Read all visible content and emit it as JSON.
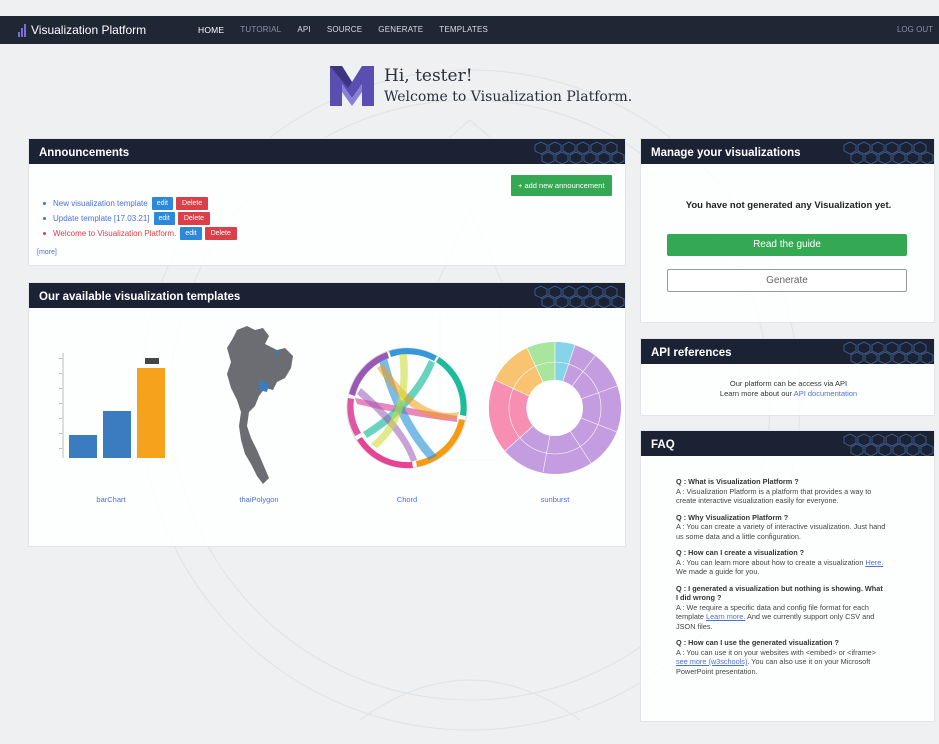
{
  "navbar": {
    "brand": "Visualization Platform",
    "links": [
      "HOME",
      "TUTORIAL",
      "API",
      "SOURCE",
      "GENERATE",
      "TEMPLATES"
    ],
    "logout": "LOG OUT"
  },
  "welcome": {
    "greeting": "Hi, tester!",
    "subtitle": "Welcome to Visualization Platform."
  },
  "announcements": {
    "title": "Announcements",
    "add_button": "+ add new announcement",
    "items": [
      {
        "text": "New visualization template",
        "edit": "edit",
        "delete": "Delete"
      },
      {
        "text": "Update template [17.03.21]",
        "edit": "edit",
        "delete": "Delete"
      },
      {
        "text": "Welcome to Visualization Platform.",
        "edit": "edit",
        "delete": "Delete"
      }
    ],
    "more": "[more]"
  },
  "templates": {
    "title": "Our available visualization templates",
    "items": [
      {
        "label": "barChart",
        "icon": "bar-chart-thumbnail"
      },
      {
        "label": "thaiPolygon",
        "icon": "thailand-map-thumbnail"
      },
      {
        "label": "Chord",
        "icon": "chord-diagram-thumbnail"
      },
      {
        "label": "sunburst",
        "icon": "sunburst-thumbnail"
      }
    ]
  },
  "manage": {
    "title": "Manage your visualizations",
    "empty_message": "You have not generated any Visualization yet.",
    "guide_button": "Read the guide",
    "generate_button": "Generate"
  },
  "api": {
    "title": "API references",
    "line1": "Our platform can be access via API",
    "line2_prefix": "Learn more about our",
    "line2_link": "API documentation"
  },
  "faq": {
    "title": "FAQ",
    "items": [
      {
        "q": "Q : What is Visualization Platform ?",
        "a": "A : Visualization Platform is a platform that provides a way to create interactive visualization easily for everyone."
      },
      {
        "q": "Q : Why Visualization Platform ?",
        "a": "A : You can create a variety of interactive visualization. Just hand us some data and a little configuration."
      },
      {
        "q": "Q : How can I create a visualization ?",
        "a": "A : You can learn more about how to create a visualization",
        "link": "Here.",
        "a2": "We made a guide for you."
      },
      {
        "q": "Q : I generated a visualization but nothing is showing. What I did wrong ?",
        "a": "A : We require a specific data and config file format for each template",
        "link": "Learn more.",
        "a2": "And we currently support only CSV and JSON files."
      },
      {
        "q": "Q : How can I use the generated visualization ?",
        "a": "A : You can use it on your websites with <embed> or <iframe>",
        "link": "see more (w3schools)",
        "a2": ". You can also use it on your Microsoft PowerPoint presentation."
      }
    ]
  },
  "colors": {
    "navbar": "#1f2634",
    "card_header": "#1b2233",
    "accent_green": "#34a853",
    "edit_blue": "#2c88d9",
    "delete_red": "#d9404a",
    "link_blue": "#4d6fd9"
  }
}
